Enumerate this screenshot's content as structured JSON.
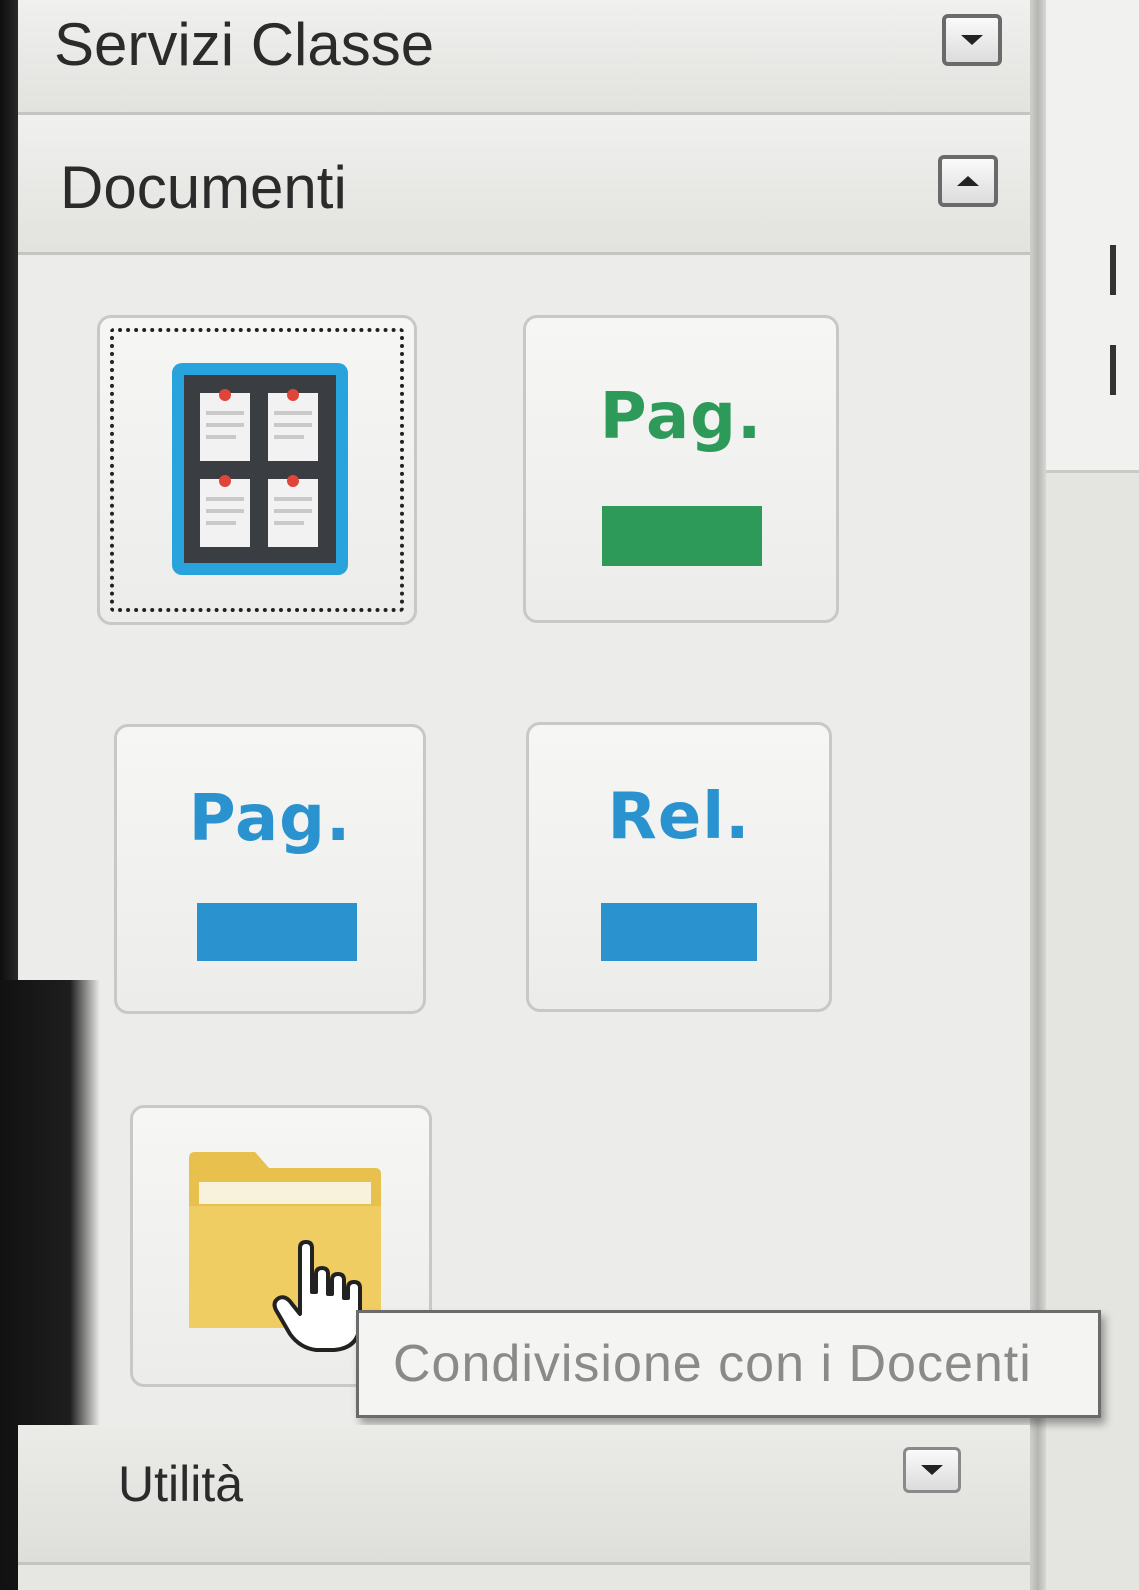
{
  "sections": [
    {
      "title": "Servizi Classe",
      "toggle": "chevron-down",
      "state": "collapsed"
    },
    {
      "title": "Documenti",
      "toggle": "chevron-up",
      "state": "expanded"
    },
    {
      "title": "Utilità",
      "toggle": "chevron-down",
      "state": "collapsed"
    }
  ],
  "tiles": [
    {
      "icon": "bulletin-board-icon",
      "label": "",
      "color": "#29a3dc",
      "focused": true
    },
    {
      "icon": "text-badge",
      "label": "Pag.",
      "color": "#2e9a5a"
    },
    {
      "icon": "text-badge",
      "label": "Pag.",
      "color": "#2a93cf"
    },
    {
      "icon": "text-badge",
      "label": "Rel.",
      "color": "#2a93cf"
    },
    {
      "icon": "folder-icon",
      "label": "",
      "color": "#e8c04e"
    }
  ],
  "tooltip": "Condivisione con i Docenti",
  "cursor": "hand-pointer-icon"
}
